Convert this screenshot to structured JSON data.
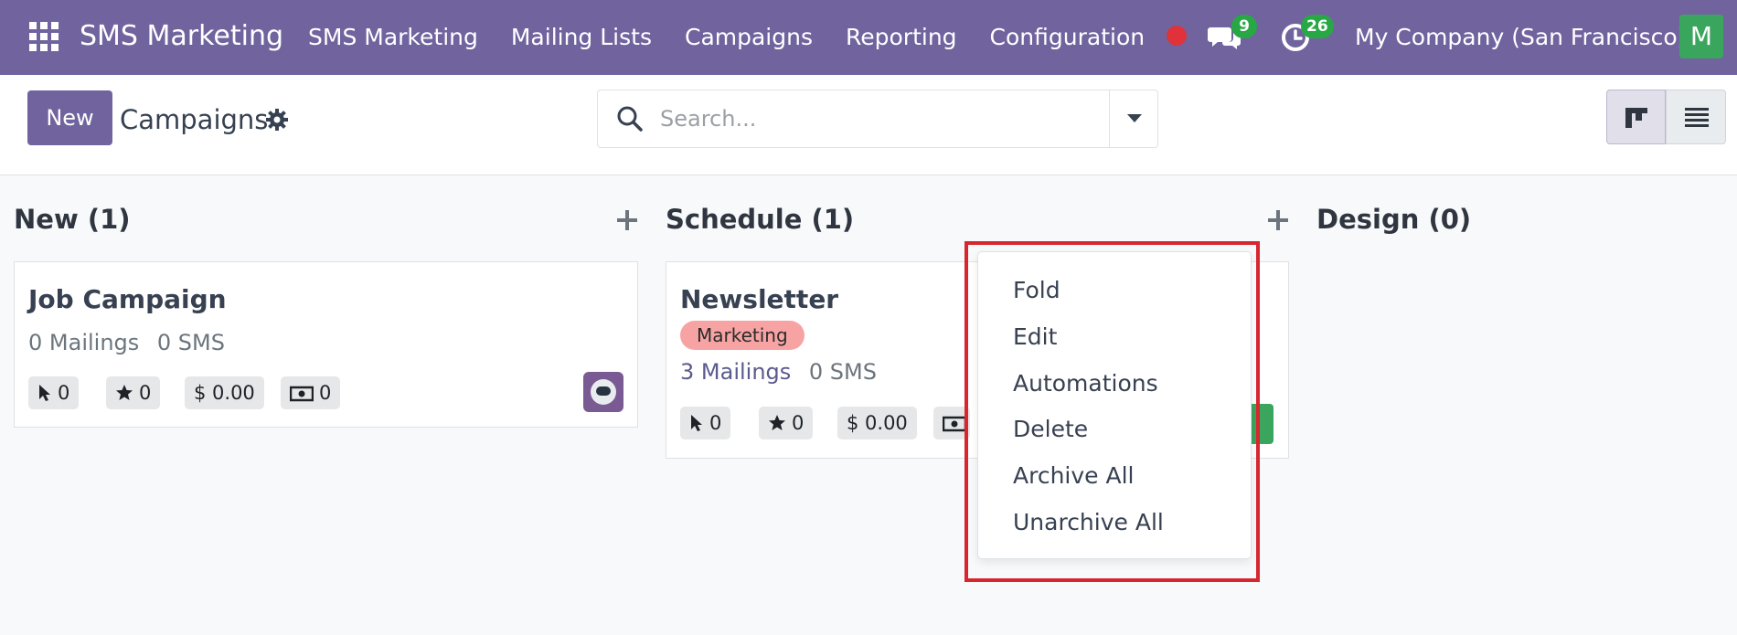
{
  "navbar": {
    "brand": "SMS Marketing",
    "menu": [
      "SMS Marketing",
      "Mailing Lists",
      "Campaigns",
      "Reporting",
      "Configuration"
    ],
    "messages_count": "9",
    "activities_count": "26",
    "company": "My Company (San Francisco)",
    "user_initial": "M"
  },
  "control": {
    "new_label": "New",
    "title": "Campaigns",
    "search_placeholder": "Search..."
  },
  "columns": [
    {
      "title": "New (1)",
      "cards": [
        {
          "title": "Job Campaign",
          "mailings": "0 Mailings",
          "sms": "0 SMS",
          "clicks": "0",
          "stars": "0",
          "revenue": "$ 0.00",
          "cost": "0"
        }
      ]
    },
    {
      "title": "Schedule (1)",
      "cards": [
        {
          "title": "Newsletter",
          "tag": "Marketing",
          "mailings": "3 Mailings",
          "sms": "0 SMS",
          "clicks": "0",
          "stars": "0",
          "revenue": "$ 0.00"
        }
      ]
    },
    {
      "title": "Design (0)",
      "cards": []
    }
  ],
  "dropdown": {
    "items": [
      "Fold",
      "Edit",
      "Automations",
      "Delete",
      "Archive All",
      "Unarchive All"
    ]
  },
  "colors": {
    "brand": "#71639e",
    "badge": "#28a745",
    "highlight": "#d7262f",
    "tag": "#f7a3a3"
  }
}
